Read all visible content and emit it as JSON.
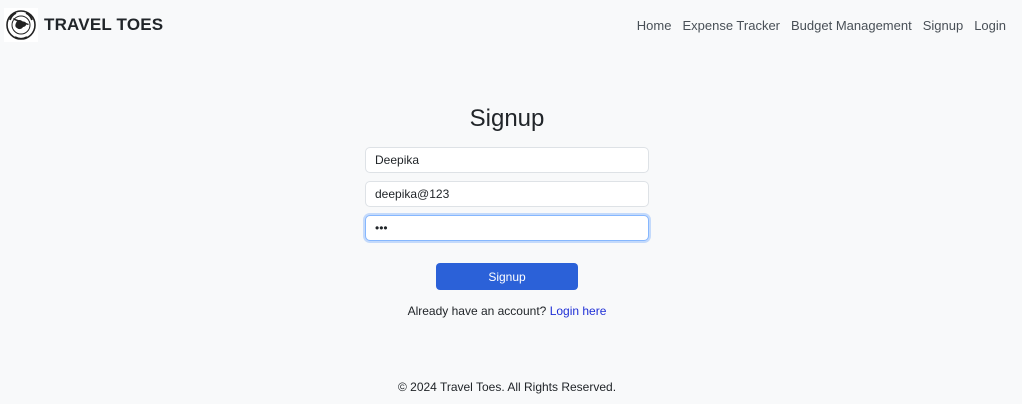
{
  "brand": {
    "name": "TRAVEL TOES"
  },
  "nav": {
    "items": [
      {
        "label": "Home"
      },
      {
        "label": "Expense Tracker"
      },
      {
        "label": "Budget Management"
      },
      {
        "label": "Signup"
      },
      {
        "label": "Login"
      }
    ]
  },
  "form": {
    "title": "Signup",
    "username": {
      "value": "Deepika"
    },
    "email": {
      "value": "deepika@123"
    },
    "password": {
      "value": "•••"
    },
    "submit_label": "Signup",
    "login_prompt": "Already have an account?",
    "login_link": "Login here"
  },
  "footer": {
    "text": "© 2024 Travel Toes. All Rights Reserved."
  },
  "colors": {
    "primary_button": "#2b61d8",
    "link": "#1f2fd6",
    "focus_ring": "#86b7fe",
    "background": "#f8f9fa"
  }
}
